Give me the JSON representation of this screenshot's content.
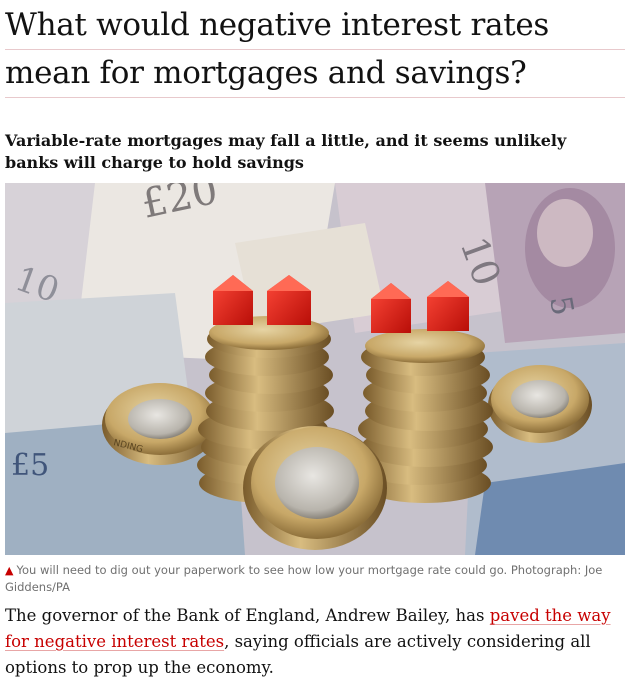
{
  "article": {
    "headline_line1": "What would negative interest rates",
    "headline_line2": "mean for mortgages and savings?",
    "standfirst": "Variable-rate mortgages may fall a little, and it seems unlikely banks will charge to hold savings",
    "caption_text": "You will need to dig out your paperwork to see how low your mortgage rate could go. Photograph: Joe Giddens/PA",
    "body_before_link": "The governor of the Bank of England, Andrew Bailey, has ",
    "body_link": "paved the way for negative interest rates",
    "body_after_link": ", saying officials are actively considering all options to prop up the economy."
  },
  "photo": {
    "banknote_text": [
      "£20",
      "10",
      "10",
      "5",
      "£5",
      "NDING"
    ],
    "icon": "caption-triangle-icon"
  },
  "colors": {
    "accent": "#c70000",
    "rule": "#e8c9cc",
    "caption": "#707070"
  }
}
